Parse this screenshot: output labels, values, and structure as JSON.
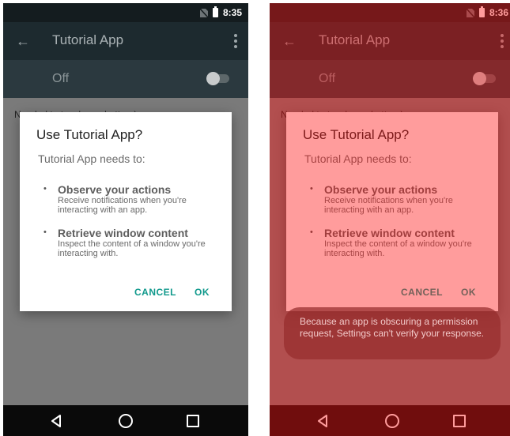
{
  "screens": [
    {
      "status_time": "8:35",
      "app_title": "Tutorial App",
      "switch_label": "Off",
      "content_text": "Needed to teach you better :)",
      "dialog": {
        "title": "Use Tutorial App?",
        "subtitle": "Tutorial App needs to:",
        "permissions": [
          {
            "title": "Observe your actions",
            "description": "Receive notifications when you're interacting with an app."
          },
          {
            "title": "Retrieve window content",
            "description": "Inspect the content of a window you're interacting with."
          }
        ],
        "cancel_label": "CANCEL",
        "ok_label": "OK"
      }
    },
    {
      "status_time": "8:36",
      "app_title": "Tutorial App",
      "switch_label": "Off",
      "content_text": "Needed to teach you better :)",
      "dialog": {
        "title": "Use Tutorial App?",
        "subtitle": "Tutorial App needs to:",
        "permissions": [
          {
            "title": "Observe your actions",
            "description": "Receive notifications when you're interacting with an app."
          },
          {
            "title": "Retrieve window content",
            "description": "Inspect the content of a window you're interacting with."
          }
        ],
        "cancel_label": "CANCEL",
        "ok_label": "OK"
      },
      "toast_text": "Because an app is obscuring a permission request, Settings can't verify your response."
    }
  ],
  "icons": {
    "back": "arrow-left-icon",
    "overflow": "more-vert-icon",
    "sim": "no-sim-icon",
    "battery": "battery-icon",
    "nav_back": "triangle-back-icon",
    "nav_home": "circle-home-icon",
    "nav_recent": "square-recent-icon"
  },
  "colors": {
    "accent": "#10998c",
    "overlay_tint": "#ff1414",
    "app_bar": "#1d2a2f"
  }
}
